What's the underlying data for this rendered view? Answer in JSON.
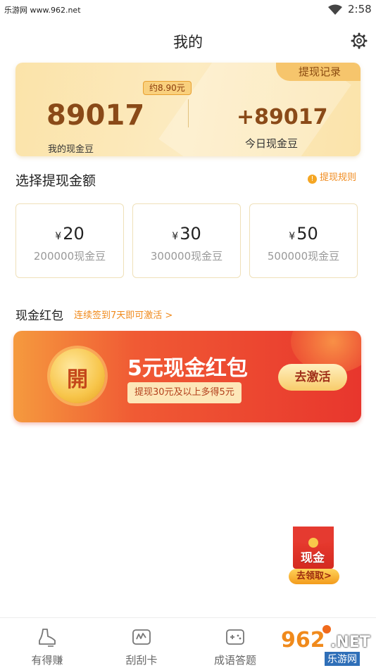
{
  "status_bar": {
    "watermark": "乐游网 www.962.net",
    "time": "2:58"
  },
  "header": {
    "title": "我的"
  },
  "balance_card": {
    "record_tab": "提现记录",
    "approx": "约8.90元",
    "balance": "89017",
    "balance_label": "我的现金豆",
    "today": "+89017",
    "today_label": "今日现金豆"
  },
  "withdraw": {
    "title": "选择提现金额",
    "rules": "提现规则",
    "options": [
      {
        "currency": "¥",
        "amount": "20",
        "beans": "200000现金豆"
      },
      {
        "currency": "¥",
        "amount": "30",
        "beans": "300000现金豆"
      },
      {
        "currency": "¥",
        "amount": "50",
        "beans": "500000现金豆"
      }
    ]
  },
  "red_packet": {
    "title": "现金红包",
    "subtitle": "连续签到7天即可激活 >",
    "coin_char": "開",
    "banner_title": "5元现金红包",
    "banner_note": "提现30元及以上多得5元",
    "button": "去激活"
  },
  "floating": {
    "label": "现金",
    "button": "去领取>"
  },
  "tabbar": [
    {
      "label": "有得赚",
      "icon": "shoe-icon"
    },
    {
      "label": "刮刮卡",
      "icon": "scratch-card-icon"
    },
    {
      "label": "成语答题",
      "icon": "gamepad-icon"
    }
  ],
  "site_watermark": {
    "big": "962",
    "net": ".NET",
    "sub": "乐游网"
  },
  "colors": {
    "accent_orange": "#f08a1c",
    "banner_red": "#e8362d",
    "card_gold": "#fbe3a9"
  }
}
